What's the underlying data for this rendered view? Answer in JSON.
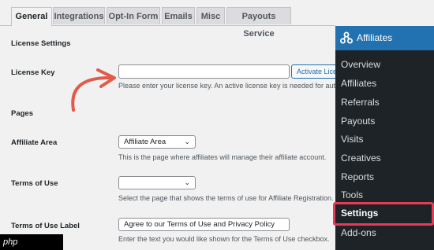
{
  "tabs": [
    "General",
    "Integrations",
    "Opt-In Form",
    "Emails",
    "Misc",
    "Payouts Service"
  ],
  "license": {
    "section_title": "License Settings",
    "key_label": "License Key",
    "key_value": "",
    "activate_label": "Activate License",
    "description": "Please enter your license key. An active license key is needed for automatic"
  },
  "pages": {
    "section_title": "Pages",
    "affiliate_area_label": "Affiliate Area",
    "affiliate_area_value": "Affiliate Area",
    "affiliate_area_desc": "This is the page where affiliates will manage their affiliate account.",
    "terms_label": "Terms of Use",
    "terms_value": "",
    "terms_desc": "Select the page that shows the terms of use for Affiliate Registration.",
    "terms_label_label": "Terms of Use Label",
    "terms_label_value": "Agree to our Terms of Use and Privacy Policy",
    "terms_label_desc": "Enter the text you would like shown for the Terms of Use checkbox."
  },
  "menu": {
    "title": "Affiliates",
    "items": [
      "Overview",
      "Affiliates",
      "Referrals",
      "Payouts",
      "Visits",
      "Creatives",
      "Reports",
      "Tools",
      "Settings",
      "Add-ons"
    ],
    "active": "Settings"
  },
  "watermark": "php",
  "colors": {
    "accent": "#2271b1",
    "highlight": "#e63a59",
    "menu_bg": "#1d2327",
    "arrow": "#e25a4b"
  }
}
